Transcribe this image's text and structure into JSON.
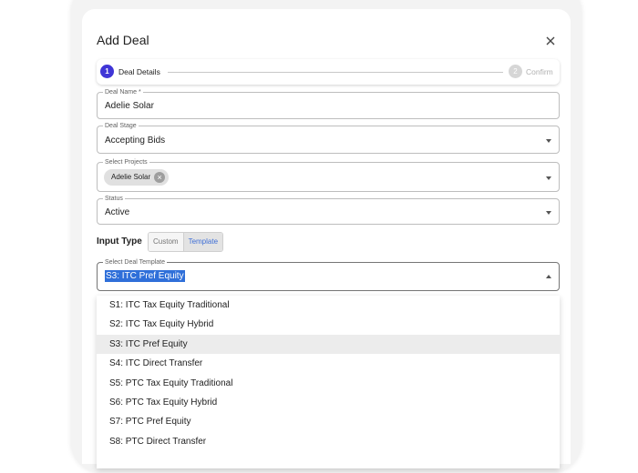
{
  "dialog": {
    "title": "Add Deal"
  },
  "stepper": {
    "steps": [
      {
        "number": "1",
        "label": "Deal Details"
      },
      {
        "number": "2",
        "label": "Confirm"
      }
    ]
  },
  "fields": {
    "deal_name": {
      "label": "Deal Name *",
      "value": "Adelie Solar"
    },
    "deal_stage": {
      "label": "Deal Stage",
      "value": "Accepting Bids"
    },
    "projects": {
      "label": "Select Projects",
      "chip": "Adelie Solar"
    },
    "status": {
      "label": "Status",
      "value": "Active"
    }
  },
  "input_type": {
    "label": "Input Type",
    "options": [
      "Custom",
      "Template"
    ],
    "selected": "Template"
  },
  "template": {
    "label": "Select Deal Template",
    "value": "S3: ITC Pref Equity",
    "options": [
      "S1: ITC Tax Equity Traditional",
      "S2: ITC Tax Equity Hybrid",
      "S3: ITC Pref Equity",
      "S4: ITC Direct Transfer",
      "S5: PTC Tax Equity Traditional",
      "S6: PTC Tax Equity Hybrid",
      "S7: PTC Pref Equity",
      "S8: PTC Direct Transfer"
    ]
  },
  "colors": {
    "accent": "#3f35d6",
    "selection": "#2f6fd9",
    "highlight": "#ececec"
  },
  "icons": {
    "close": "close-icon",
    "chip_remove": "cancel-circle-icon"
  }
}
